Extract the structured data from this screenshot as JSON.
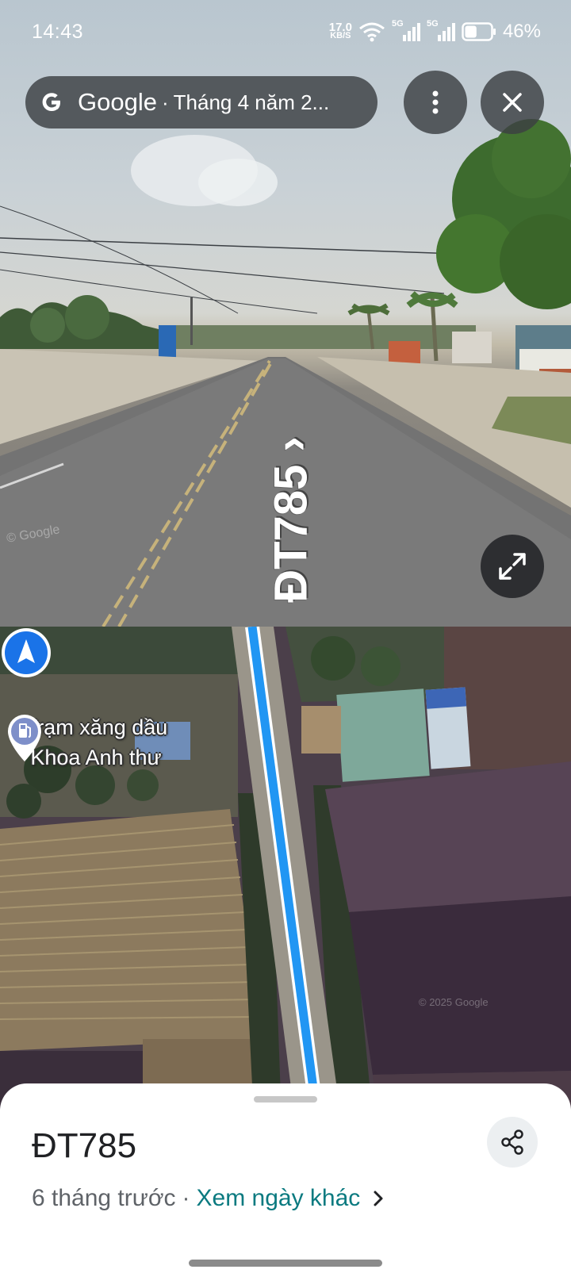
{
  "status_bar": {
    "time": "14:43",
    "net_speed_value": "17.0",
    "net_speed_unit": "KB/S",
    "signal_1_label": "5G",
    "signal_2_label": "5G",
    "battery_percent": "46%",
    "battery_level": 0.46
  },
  "street_view": {
    "brand": "Google",
    "separator": "·",
    "date": "Tháng 4 năm 2...",
    "road_label": "ĐT785 ›",
    "watermark": "© Google",
    "icons": {
      "google": "google-g-icon",
      "more": "more-vert-icon",
      "close": "close-icon",
      "expand": "expand-icon"
    }
  },
  "map": {
    "poi_name_line1": "Trạm xăng dầu",
    "poi_name_line2": "Khoa Anh thư",
    "poi_icon": "gas-station-icon",
    "watermark": "© 2025 Google",
    "route_color": "#2196f3"
  },
  "sheet": {
    "title": "ĐT785",
    "subtitle_time": "6 tháng trước",
    "subtitle_sep": "·",
    "link_label": "Xem ngày khác",
    "link_color": "#0b7a80"
  }
}
